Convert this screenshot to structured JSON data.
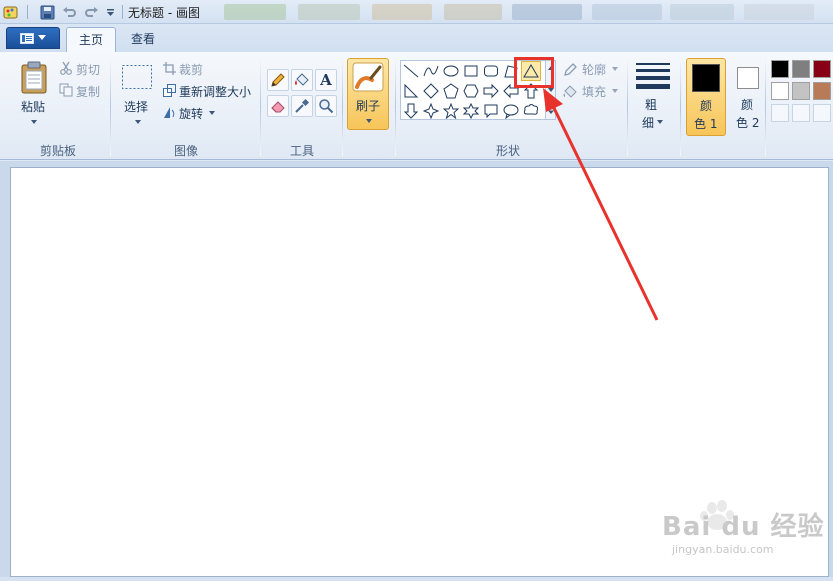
{
  "window": {
    "title": "无标题 - 画图"
  },
  "tabs": [
    {
      "label": "主页",
      "active": true
    },
    {
      "label": "查看",
      "active": false
    }
  ],
  "clipboard": {
    "paste": "粘贴",
    "cut": "剪切",
    "copy": "复制",
    "group": "剪贴板"
  },
  "image": {
    "select": "选择",
    "crop": "裁剪",
    "resize": "重新调整大小",
    "rotate": "旋转",
    "group": "图像"
  },
  "tools": {
    "group": "工具",
    "text_glyph": "A"
  },
  "brushes": {
    "label": "刷子"
  },
  "shapes": {
    "outline": "轮廓",
    "fill": "填充",
    "group": "形状",
    "selected": "triangle"
  },
  "size": {
    "label_top": "粗",
    "label_bottom": "细"
  },
  "colors": {
    "color1_top": "颜",
    "color1_bottom": "色 1",
    "color2_top": "颜",
    "color2_bottom": "色 2",
    "color1": "#000000",
    "color2": "#ffffff",
    "palette_row1": [
      "#000000",
      "#7f7f7f",
      "#880015"
    ],
    "palette_row2": [
      "#ffffff",
      "#c3c3c3",
      "#b97a57"
    ]
  },
  "accent": {
    "highlight": "#e8322c",
    "ribbon_selected": "#f7c559"
  },
  "watermark": {
    "brand": "Bai du 经验",
    "url": "jingyan.baidu.com"
  }
}
